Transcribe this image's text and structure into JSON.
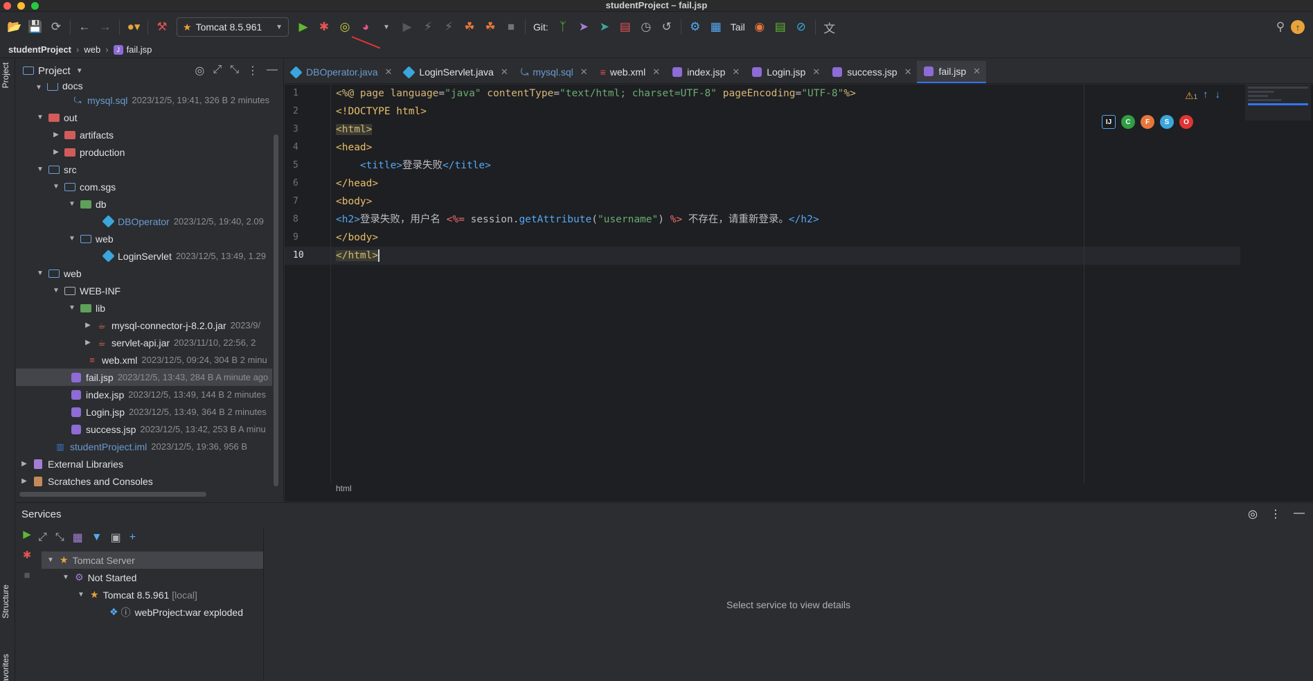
{
  "window": {
    "title": "studentProject – fail.jsp"
  },
  "toolbar": {
    "run_config": "Tomcat 8.5.961",
    "git_label": "Git:",
    "tail_label": "Tail"
  },
  "breadcrumb": {
    "project": "studentProject",
    "folder": "web",
    "file": "fail.jsp"
  },
  "side_tabs": {
    "project": "Project",
    "structure": "Structure",
    "favorites": "Favorites"
  },
  "project_panel": {
    "title": "Project",
    "rows": [
      {
        "name": "docs",
        "meta": ""
      },
      {
        "name": "mysql.sql",
        "meta": "2023/12/5, 19:41, 326 B 2 minutes"
      },
      {
        "name": "out",
        "meta": ""
      },
      {
        "name": "artifacts",
        "meta": ""
      },
      {
        "name": "production",
        "meta": ""
      },
      {
        "name": "src",
        "meta": ""
      },
      {
        "name": "com.sgs",
        "meta": ""
      },
      {
        "name": "db",
        "meta": ""
      },
      {
        "name": "DBOperator",
        "meta": "2023/12/5, 19:40, 2.09"
      },
      {
        "name": "web",
        "meta": ""
      },
      {
        "name": "LoginServlet",
        "meta": "2023/12/5, 13:49, 1.29"
      },
      {
        "name": "web",
        "meta": ""
      },
      {
        "name": "WEB-INF",
        "meta": ""
      },
      {
        "name": "lib",
        "meta": ""
      },
      {
        "name": "mysql-connector-j-8.2.0.jar",
        "meta": "2023/9/"
      },
      {
        "name": "servlet-api.jar",
        "meta": "2023/11/10, 22:56, 2"
      },
      {
        "name": "web.xml",
        "meta": "2023/12/5, 09:24, 304 B 2 minu"
      },
      {
        "name": "fail.jsp",
        "meta": "2023/12/5, 13:43, 284 B A minute ago"
      },
      {
        "name": "index.jsp",
        "meta": "2023/12/5, 13:49, 144 B 2 minutes"
      },
      {
        "name": "Login.jsp",
        "meta": "2023/12/5, 13:49, 364 B 2 minutes"
      },
      {
        "name": "success.jsp",
        "meta": "2023/12/5, 13:42, 253 B A minu"
      },
      {
        "name": "studentProject.iml",
        "meta": "2023/12/5, 19:36, 956 B"
      },
      {
        "name": "External Libraries",
        "meta": ""
      },
      {
        "name": "Scratches and Consoles",
        "meta": ""
      }
    ]
  },
  "tabs": [
    {
      "label": "DBOperator.java"
    },
    {
      "label": "LoginServlet.java"
    },
    {
      "label": "mysql.sql"
    },
    {
      "label": "web.xml"
    },
    {
      "label": "index.jsp"
    },
    {
      "label": "Login.jsp"
    },
    {
      "label": "success.jsp"
    },
    {
      "label": "fail.jsp"
    }
  ],
  "editor": {
    "line_numbers": [
      "1",
      "2",
      "3",
      "4",
      "5",
      "6",
      "7",
      "8",
      "9",
      "10"
    ],
    "warning_count": "1",
    "breadcrumb_status": "html",
    "code": {
      "l1_open": "<%@ ",
      "l1_kw": "page ",
      "l1_a1": "language",
      "l1_v1": "\"java\"",
      "l1_a2": " contentType",
      "l1_v2": "\"text/html; charset=UTF-8\"",
      "l1_a3": " pageEncoding",
      "l1_v3": "\"UTF-8\"",
      "l1_close": "%>",
      "l2": "<!DOCTYPE html>",
      "l3": "<html>",
      "l4": "<head>",
      "l5_open": "<title>",
      "l5_text": "登录失败",
      "l5_close": "</title>",
      "l6": "</head>",
      "l7": "<body>",
      "l8_open": "<h2>",
      "l8_text1": "登录失败，用户名 ",
      "l8_expr_open": "<%=",
      "l8_obj": " session.",
      "l8_method": "getAttribute",
      "l8_paren_open": "(",
      "l8_arg": "\"username\"",
      "l8_paren_close": ") ",
      "l8_expr_close": "%>",
      "l8_text2": " 不存在，请重新登录。",
      "l8_close": "</h2>",
      "l9": "</body>",
      "l10": "</html>"
    }
  },
  "services": {
    "title": "Services",
    "detail_placeholder": "Select service to view details",
    "tree": {
      "server": "Tomcat Server",
      "status": "Not Started",
      "instance": "Tomcat 8.5.961",
      "instance_tag": "[local]",
      "artifact": "webProject:war exploded"
    }
  },
  "colors": {
    "accent": "#3574f0",
    "run_green": "#5fb832",
    "debug_red": "#e55353",
    "selection": "#43454a"
  }
}
